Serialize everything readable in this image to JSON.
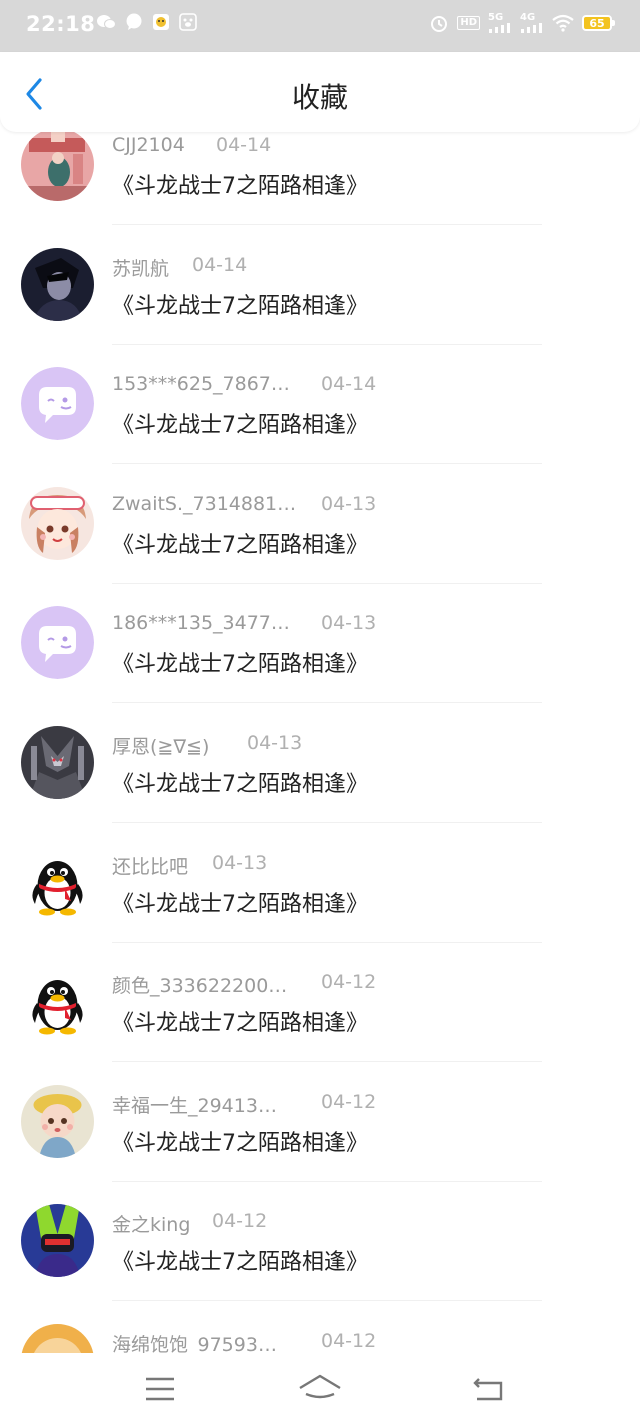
{
  "status_bar": {
    "time": "22:18",
    "network_5g": "5G",
    "network_4g": "4G",
    "hd_label": "HD",
    "battery": "65"
  },
  "header": {
    "title": "收藏",
    "back_icon": "chevron-left-icon"
  },
  "items": [
    {
      "user": "CJJ2104",
      "date": "04-14",
      "work": "《斗龙战士7之陌路相逢》",
      "avatar": "photo-pink"
    },
    {
      "user": "苏凯航",
      "date": "04-14",
      "work": "《斗龙战士7之陌路相逢》",
      "avatar": "photo-dark"
    },
    {
      "user": "153***625_7867…",
      "date": "04-14",
      "work": "《斗龙战士7之陌路相逢》",
      "avatar": "default-chat"
    },
    {
      "user": "ZwaitS._7314881…",
      "date": "04-13",
      "work": "《斗龙战士7之陌路相逢》",
      "avatar": "photo-anime"
    },
    {
      "user": "186***135_3477…",
      "date": "04-13",
      "work": "《斗龙战士7之陌路相逢》",
      "avatar": "default-chat"
    },
    {
      "user": "厚恩(≧∇≦)",
      "date": "04-13",
      "work": "《斗龙战士7之陌路相逢》",
      "avatar": "photo-robot"
    },
    {
      "user": "还比比吧",
      "date": "04-13",
      "work": "《斗龙战士7之陌路相逢》",
      "avatar": "penguin"
    },
    {
      "user": "颜色_333622200…",
      "date": "04-12",
      "work": "《斗龙战士7之陌路相逢》",
      "avatar": "penguin"
    },
    {
      "user": "幸福一生_29413…",
      "date": "04-12",
      "work": "《斗龙战士7之陌路相逢》",
      "avatar": "photo-doll"
    },
    {
      "user": "金之king",
      "date": "04-12",
      "work": "《斗龙战士7之陌路相逢》",
      "avatar": "photo-green"
    },
    {
      "user": "海绵饱饱_97593…",
      "date": "04-12",
      "work": "",
      "avatar": "photo-orange"
    }
  ],
  "nav": {
    "menu_icon": "menu-icon",
    "home_icon": "home-icon",
    "back_icon": "back-icon"
  },
  "colors": {
    "accent": "#1e88e5",
    "status_bar_bg": "#d8d8d8",
    "battery": "#f3c320",
    "default_avatar": "#d9c5f5"
  }
}
